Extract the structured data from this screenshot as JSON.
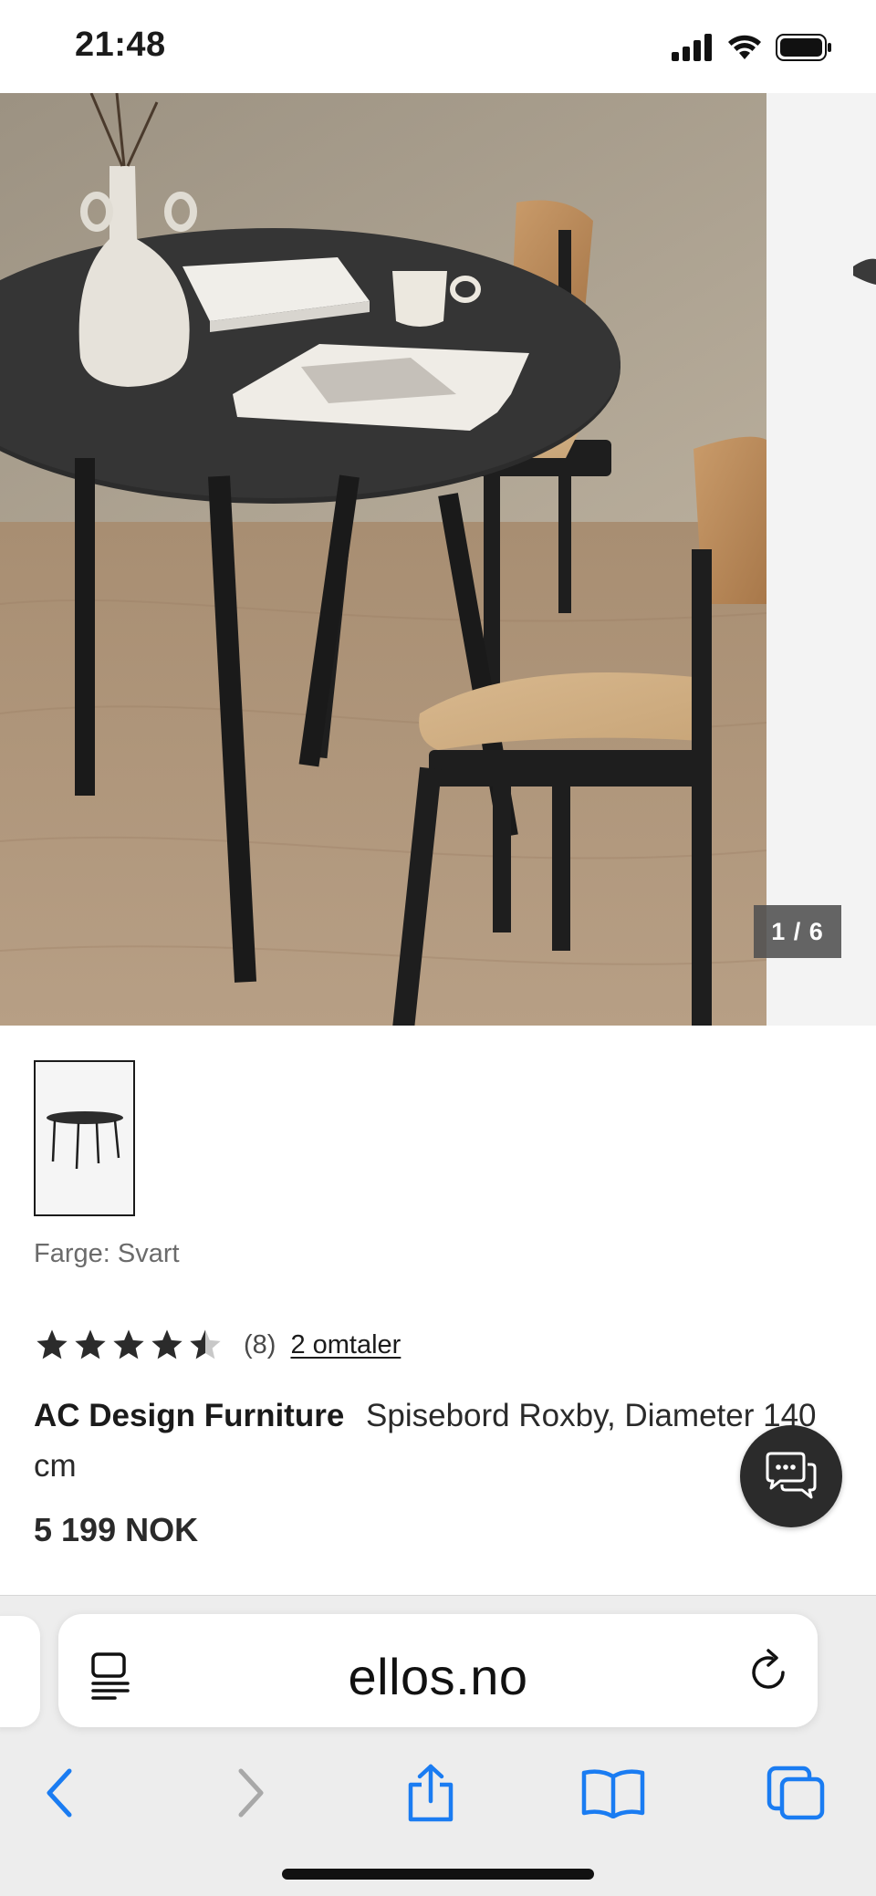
{
  "status_bar": {
    "time": "21:48"
  },
  "gallery": {
    "page_indicator": "1 / 6",
    "current_image": 1,
    "total_images": 6
  },
  "product": {
    "color_label": "Farge: Svart",
    "rating": 4.5,
    "rating_count": "(8)",
    "reviews_link": "2 omtaler",
    "brand": "AC Design Furniture",
    "name": "Spisebord Roxby, Diameter 140 cm",
    "price": "5 199 NOK"
  },
  "browser": {
    "url": "ellos.no"
  },
  "colors": {
    "accent_blue": "#1a7cf2",
    "inactive_gray": "#a8a8a8",
    "text_dark": "#1b1b1b",
    "chat_bg": "#2b2b2b"
  },
  "icons": {
    "status": [
      "signal-icon",
      "wifi-icon",
      "battery-icon"
    ],
    "toolbar": [
      "back-icon",
      "forward-icon",
      "share-icon",
      "bookmarks-icon",
      "tabs-icon"
    ]
  }
}
